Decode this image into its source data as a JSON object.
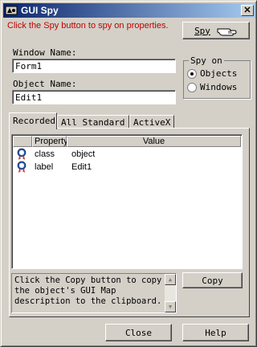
{
  "window": {
    "title": "GUI Spy"
  },
  "instruction": "Click the Spy button to spy on properties.",
  "spy_button": {
    "label": "Spy",
    "icon": "pointing-hand-icon"
  },
  "window_name": {
    "label": "Window Name:",
    "value": "Form1"
  },
  "object_name": {
    "label": "Object Name:",
    "value": "Edit1"
  },
  "spy_on": {
    "legend": "Spy on",
    "options": [
      {
        "label": "Objects",
        "checked": true
      },
      {
        "label": "Windows",
        "checked": false
      }
    ]
  },
  "tabs": [
    {
      "label": "Recorded",
      "active": true
    },
    {
      "label": "All Standard",
      "active": false
    },
    {
      "label": "ActiveX",
      "active": false
    }
  ],
  "table": {
    "headers": {
      "property": "Property",
      "value": "Value"
    },
    "rows": [
      {
        "property": "class",
        "value": "object"
      },
      {
        "property": "label",
        "value": "Edit1"
      }
    ]
  },
  "description": "Click the Copy button to copy the object's GUI Map description to the clipboard.",
  "copy_button": "Copy",
  "close_button": "Close",
  "help_button": "Help"
}
